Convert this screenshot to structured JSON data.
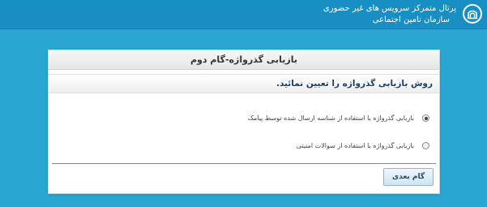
{
  "header": {
    "portal_title": "پرتال متمرکز سرویس های غیر حضوری",
    "org_name": "سازمان تامین اجتماعی",
    "logo_icon": "ssi-logo-icon"
  },
  "panel": {
    "title": "بازیابی گذرواژه-گام دوم",
    "section_title": "روش بازیابی گذرواژه را تعیین نمائید.",
    "options": [
      {
        "label": "بازیابی گذرواژه با استفاده از شناسه ارسال شده توسط پیامک",
        "selected": true
      },
      {
        "label": "بازیابی گذرواژه با استفاده از سوالات امنیتی",
        "selected": false
      }
    ],
    "next_button_label": "گام بعدی"
  },
  "colors": {
    "background": "#2aa6d3",
    "topbar": "#168fc4",
    "section_title": "#1f3f60"
  }
}
